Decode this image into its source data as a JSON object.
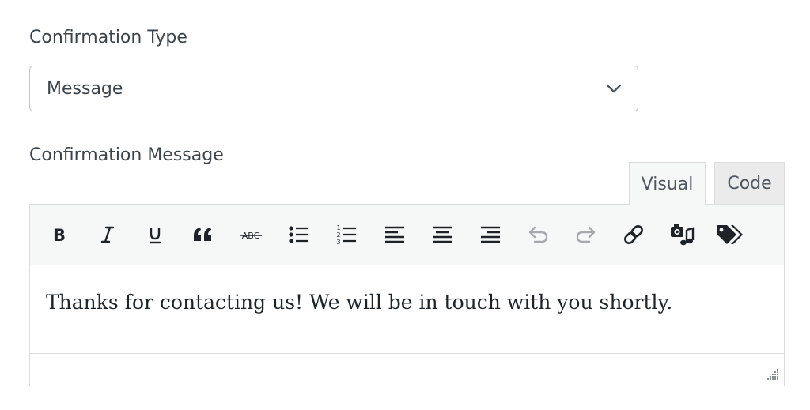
{
  "confirmation_type": {
    "label": "Confirmation Type",
    "selected": "Message",
    "icon": "chevron-down-icon"
  },
  "confirmation_message": {
    "label": "Confirmation Message",
    "tabs": [
      {
        "label": "Visual",
        "active": true
      },
      {
        "label": "Code",
        "active": false
      }
    ],
    "toolbar": [
      "bold-icon",
      "italic-icon",
      "underline-icon",
      "blockquote-icon",
      "strikethrough-icon",
      "bullet-list-icon",
      "numbered-list-icon",
      "align-left-icon",
      "align-center-icon",
      "align-right-icon",
      "undo-icon",
      "redo-icon",
      "link-icon",
      "add-media-icon",
      "smart-tags-icon"
    ],
    "content": "Thanks for contacting us! We will be in touch with you shortly."
  },
  "colors": {
    "text": "#3c434a",
    "border": "#dcdcde",
    "toolbar_bg": "#f6f7f7",
    "icon": "#1d2327",
    "icon_disabled": "#a7aaad"
  }
}
